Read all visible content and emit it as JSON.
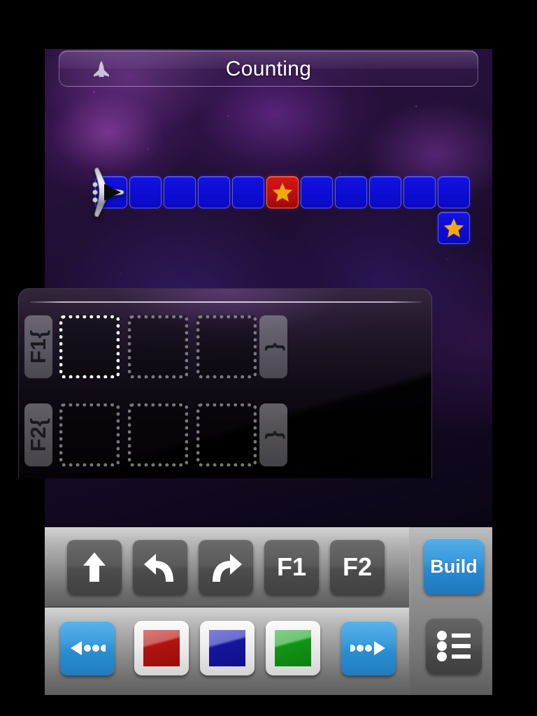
{
  "app": {
    "title": "Counting",
    "ship_icon": "spaceship-icon"
  },
  "board": {
    "tile_count": 11,
    "tiles": [
      {
        "index": 0,
        "color": "#0d0dd4",
        "color_name": "blue",
        "star": false
      },
      {
        "index": 1,
        "color": "#0d0dd4",
        "color_name": "blue",
        "star": false
      },
      {
        "index": 2,
        "color": "#0d0dd4",
        "color_name": "blue",
        "star": false
      },
      {
        "index": 3,
        "color": "#0d0dd4",
        "color_name": "blue",
        "star": false
      },
      {
        "index": 4,
        "color": "#0d0dd4",
        "color_name": "blue",
        "star": false
      },
      {
        "index": 5,
        "color": "#c01010",
        "color_name": "red",
        "star": true
      },
      {
        "index": 6,
        "color": "#0d0dd4",
        "color_name": "blue",
        "star": false
      },
      {
        "index": 7,
        "color": "#0d0dd4",
        "color_name": "blue",
        "star": false
      },
      {
        "index": 8,
        "color": "#0d0dd4",
        "color_name": "blue",
        "star": false
      },
      {
        "index": 9,
        "color": "#0d0dd4",
        "color_name": "blue",
        "star": false
      },
      {
        "index": 10,
        "color": "#0d0dd4",
        "color_name": "blue",
        "star": false
      }
    ],
    "goal_tile": {
      "color": "#0d0dd4",
      "color_name": "blue",
      "star": true
    },
    "ship": {
      "tile_index": 0,
      "facing": "right"
    },
    "star_color": "#f5a816"
  },
  "program": {
    "functions": [
      {
        "name": "F1{",
        "close": "}",
        "slots": [
          {
            "index": 0,
            "command": null,
            "active": true
          },
          {
            "index": 1,
            "command": null,
            "active": false
          },
          {
            "index": 2,
            "command": null,
            "active": false
          }
        ]
      },
      {
        "name": "F2{",
        "close": "}",
        "slots": [
          {
            "index": 0,
            "command": null,
            "active": false
          },
          {
            "index": 1,
            "command": null,
            "active": false
          },
          {
            "index": 2,
            "command": null,
            "active": false
          }
        ]
      }
    ]
  },
  "toolbar": {
    "commands": [
      {
        "id": "forward",
        "icon": "arrow-up-icon",
        "label": ""
      },
      {
        "id": "turn-left",
        "icon": "turn-left-icon",
        "label": ""
      },
      {
        "id": "turn-right",
        "icon": "turn-right-icon",
        "label": ""
      },
      {
        "id": "call-f1",
        "icon": "",
        "label": "F1"
      },
      {
        "id": "call-f2",
        "icon": "",
        "label": "F2"
      }
    ],
    "palette": [
      {
        "id": "prev-page",
        "icon": "prev-page-icon",
        "type": "page"
      },
      {
        "id": "color-red",
        "icon": "red-swatch-icon",
        "type": "color",
        "color": "#b01410"
      },
      {
        "id": "color-blue",
        "icon": "blue-swatch-icon",
        "type": "color",
        "color": "#16169e"
      },
      {
        "id": "color-green",
        "icon": "green-swatch-icon",
        "type": "color",
        "color": "#129416"
      },
      {
        "id": "next-page",
        "icon": "next-page-icon",
        "type": "page"
      }
    ],
    "build_label": "Build",
    "menu_icon": "list-menu-icon",
    "accent_blue": "#2b8ed2"
  }
}
